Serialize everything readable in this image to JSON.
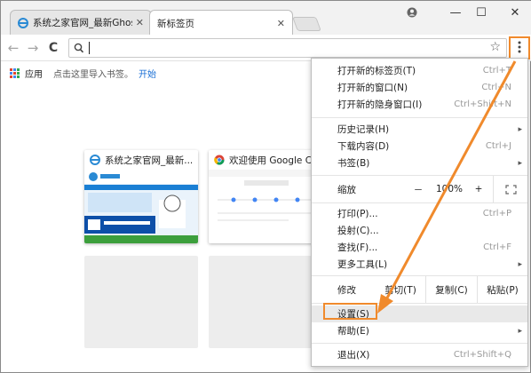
{
  "window": {
    "tabs": [
      {
        "title": "系统之家官网_最新Ghos",
        "close": "✕"
      },
      {
        "title": "新标签页",
        "close": "✕"
      }
    ],
    "controls": {
      "profile": "👤",
      "minimize": "—",
      "maximize": "☐",
      "close": "✕"
    }
  },
  "toolbar": {
    "back": "←",
    "forward": "→",
    "reload": "C",
    "address_value": "",
    "star": "☆",
    "menu_icon": "⋮"
  },
  "bookmarks_bar": {
    "apps_label": "应用",
    "hint": "点击这里导入书签。",
    "link": "开始"
  },
  "tiles": [
    {
      "title": "系统之家官网_最新..."
    },
    {
      "title": "欢迎使用 Google C..."
    }
  ],
  "menu": {
    "items_top": [
      {
        "label": "打开新的标签页(T)",
        "shortcut": "Ctrl+T"
      },
      {
        "label": "打开新的窗口(N)",
        "shortcut": "Ctrl+N"
      },
      {
        "label": "打开新的隐身窗口(I)",
        "shortcut": "Ctrl+Shift+N"
      }
    ],
    "items_history": [
      {
        "label": "历史记录(H)",
        "shortcut": "",
        "submenu": "▸"
      },
      {
        "label": "下载内容(D)",
        "shortcut": "Ctrl+J"
      },
      {
        "label": "书签(B)",
        "shortcut": "",
        "submenu": "▸"
      }
    ],
    "zoom": {
      "label": "缩放",
      "minus": "－",
      "value": "100%",
      "plus": "+",
      "fullscreen": "⛶"
    },
    "items_tools": [
      {
        "label": "打印(P)...",
        "shortcut": "Ctrl+P"
      },
      {
        "label": "投射(C)...",
        "shortcut": ""
      },
      {
        "label": "查找(F)...",
        "shortcut": "Ctrl+F"
      },
      {
        "label": "更多工具(L)",
        "shortcut": "",
        "submenu": "▸"
      }
    ],
    "edit": {
      "label": "修改",
      "cut": "剪切(T)",
      "copy": "复制(C)",
      "paste": "粘贴(P)"
    },
    "items_settings": [
      {
        "label": "设置(S)",
        "shortcut": ""
      },
      {
        "label": "帮助(E)",
        "shortcut": "",
        "submenu": "▸"
      }
    ],
    "exit": {
      "label": "退出(X)",
      "shortcut": "Ctrl+Shift+Q"
    }
  },
  "colors": {
    "annotation": "#f08a2c",
    "link": "#1a6fd5"
  }
}
